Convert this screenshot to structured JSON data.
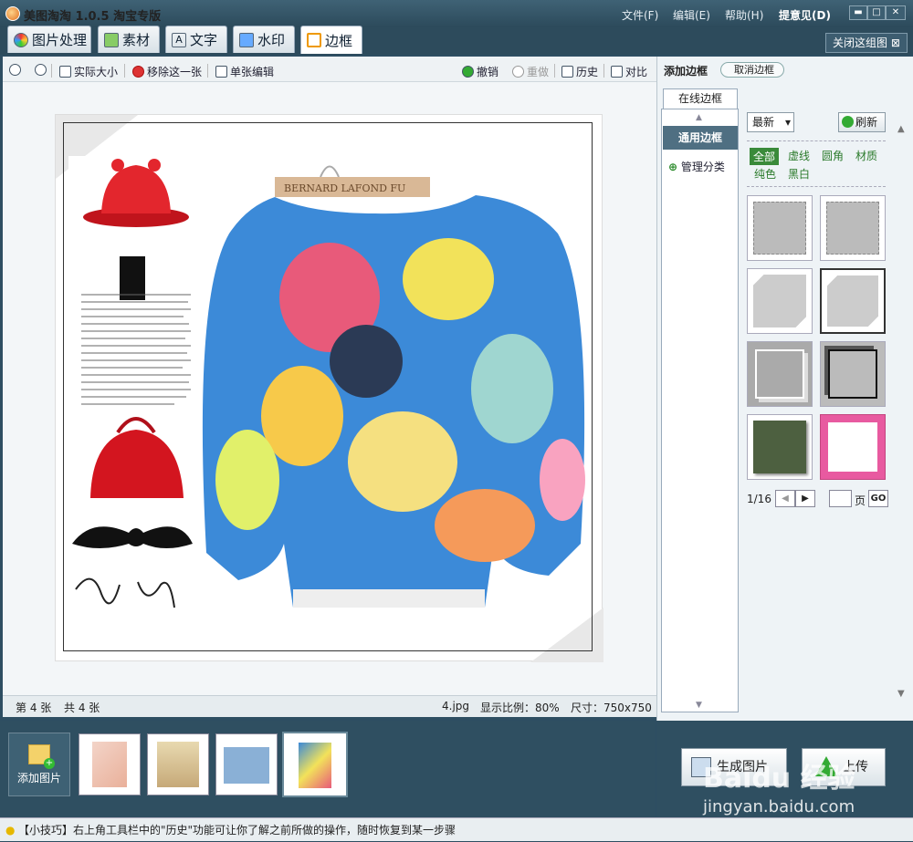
{
  "app": {
    "title": "美图淘淘 1.0.5 淘宝专版"
  },
  "menu": {
    "file": "文件(F)",
    "edit": "编辑(E)",
    "help": "帮助(H)",
    "feedback": "提意见(D)"
  },
  "tabs": [
    {
      "label": "图片处理"
    },
    {
      "label": "素材"
    },
    {
      "label": "文字"
    },
    {
      "label": "水印"
    },
    {
      "label": "边框"
    }
  ],
  "close_group": "关闭这组图",
  "toolbar": {
    "actual_size": "实际大小",
    "remove_this": "移除这一张",
    "single_edit": "单张编辑",
    "undo": "撤销",
    "redo": "重做",
    "history": "历史",
    "compare": "对比"
  },
  "image": {
    "hanger_text": "BERNARD LAFOND FU",
    "collage_text": "Lovely Girl",
    "new_badge": "NEW"
  },
  "status": {
    "current": "第 4 张",
    "total": "共 4 张",
    "file": "4.jpg",
    "ratio": "显示比例：80%",
    "size": "尺寸：750x750"
  },
  "panel": {
    "title": "添加边框",
    "cancel": "取消边框",
    "online_tab": "在线边框",
    "category": "通用边框",
    "manage": "管理分类",
    "sort": "最新",
    "refresh": "刷新",
    "filters": [
      "全部",
      "虚线",
      "圆角",
      "材质",
      "纯色",
      "黑白"
    ],
    "page": "1/16",
    "page_suffix": "页",
    "go": "GO"
  },
  "filmstrip": {
    "add": "添加图片"
  },
  "buttons": {
    "generate": "生成图片",
    "upload": "上传"
  },
  "watermark": {
    "brand": "Baidu 经验",
    "url": "jingyan.baidu.com"
  },
  "tip": "【小技巧】右上角工具栏中的\"历史\"功能可让你了解之前所做的操作，随时恢复到某一步骤"
}
